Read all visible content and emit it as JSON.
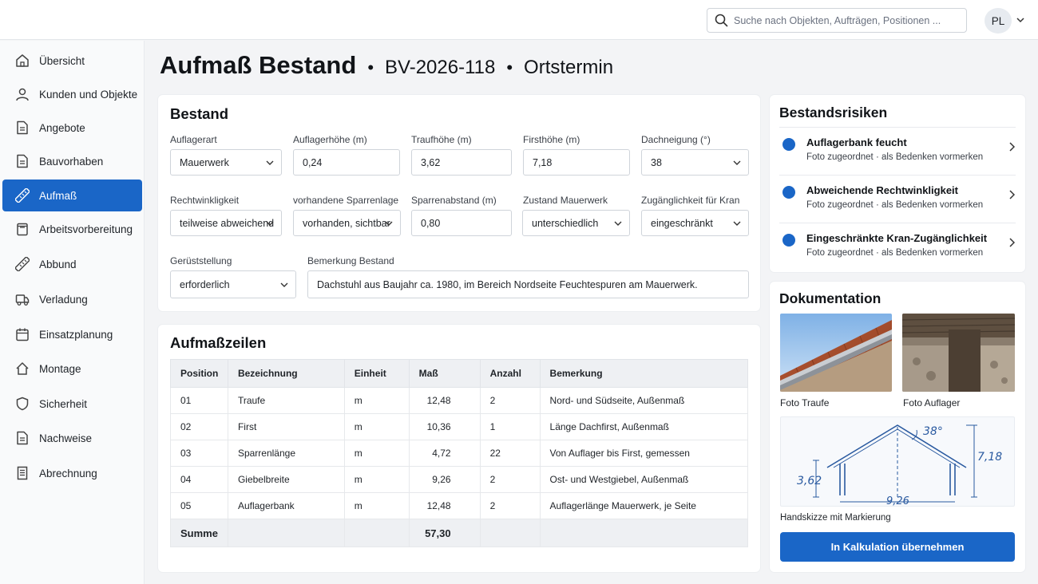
{
  "header": {
    "search_placeholder": "Suche nach Objekten, Aufträgen, Positionen ...",
    "avatar_initials": "PL"
  },
  "sidebar": {
    "items": [
      {
        "label": "Übersicht",
        "icon": "home-icon",
        "active": false
      },
      {
        "label": "Kunden und Objekte",
        "icon": "user-icon",
        "active": false
      },
      {
        "label": "Angebote",
        "icon": "document-icon",
        "active": false
      },
      {
        "label": "Bauvorhaben",
        "icon": "document-icon",
        "active": false
      },
      {
        "label": "Aufmaß",
        "icon": "ruler-icon",
        "active": true
      },
      {
        "label": "Arbeitsvorbereitung",
        "icon": "clipboard-icon",
        "active": false
      },
      {
        "label": "Abbund",
        "icon": "ruler-icon",
        "active": false
      },
      {
        "label": "Verladung",
        "icon": "truck-icon",
        "active": false
      },
      {
        "label": "Einsatzplanung",
        "icon": "calendar-icon",
        "active": false
      },
      {
        "label": "Montage",
        "icon": "house-icon",
        "active": false
      },
      {
        "label": "Sicherheit",
        "icon": "shield-icon",
        "active": false
      },
      {
        "label": "Nachweise",
        "icon": "document-icon",
        "active": false
      },
      {
        "label": "Abrechnung",
        "icon": "receipt-icon",
        "active": false
      }
    ]
  },
  "page": {
    "title": "Aufmaß Bestand",
    "separator": "•",
    "project_id": "BV-2026-118",
    "context": "Ortstermin"
  },
  "bestand": {
    "heading": "Bestand",
    "fields": {
      "auflagerart": {
        "label": "Auflagerart",
        "value": "Mauerwerk"
      },
      "auflagerhoehe": {
        "label": "Auflagerhöhe (m)",
        "value": "0,24"
      },
      "traufhoehe": {
        "label": "Traufhöhe (m)",
        "value": "3,62"
      },
      "firsthoehe": {
        "label": "Firsthöhe (m)",
        "value": "7,18"
      },
      "dachneigung": {
        "label": "Dachneigung (°)",
        "value": "38"
      },
      "rechtwinkligkeit": {
        "label": "Rechtwinkligkeit",
        "value": "teilweise abweichend"
      },
      "sparrenlage": {
        "label": "vorhandene Sparrenlage",
        "value": "vorhanden, sichtbar"
      },
      "sparrenabstand": {
        "label": "Sparrenabstand (m)",
        "value": "0,80"
      },
      "zustand": {
        "label": "Zustand Mauerwerk",
        "value": "unterschiedlich"
      },
      "kran": {
        "label": "Zugänglichkeit für Kran",
        "value": "eingeschränkt"
      },
      "geruest": {
        "label": "Gerüststellung",
        "value": "erforderlich"
      },
      "bemerkung": {
        "label": "Bemerkung Bestand",
        "value": "Dachstuhl aus Baujahr ca. 1980, im Bereich Nordseite Feuchtespuren am Mauerwerk."
      }
    }
  },
  "aufmass": {
    "heading": "Aufmaßzeilen",
    "columns": [
      "Position",
      "Bezeichnung",
      "Einheit",
      "Maß",
      "Anzahl",
      "Bemerkung"
    ],
    "rows": [
      [
        "01",
        "Traufe",
        "m",
        "12,48",
        "2",
        "Nord- und Südseite, Außenmaß"
      ],
      [
        "02",
        "First",
        "m",
        "10,36",
        "1",
        "Länge Dachfirst, Außenmaß"
      ],
      [
        "03",
        "Sparrenlänge",
        "m",
        "4,72",
        "22",
        "Von Auflager bis First, gemessen"
      ],
      [
        "04",
        "Giebelbreite",
        "m",
        "9,26",
        "2",
        "Ost- und Westgiebel, Außenmaß"
      ],
      [
        "05",
        "Auflagerbank",
        "m",
        "12,48",
        "2",
        "Auflagerlänge Mauerwerk, je Seite"
      ]
    ],
    "sum_label": "Summe",
    "sum_value": "57,30"
  },
  "risks": {
    "heading": "Bestandsrisiken",
    "items": [
      {
        "title": "Auflagerbank feucht",
        "meta": "Foto zugeordnet · als Bedenken vormerken"
      },
      {
        "title": "Abweichende Rechtwinkligkeit",
        "meta": "Foto zugeordnet · als Bedenken vormerken"
      },
      {
        "title": "Eingeschränkte Kran-Zugänglichkeit",
        "meta": "Foto zugeordnet · als Bedenken vormerken"
      }
    ]
  },
  "docs": {
    "heading": "Dokumentation",
    "photo1_label": "Foto Traufe",
    "photo2_label": "Foto Auflager",
    "sketch_label": "Handskizze mit Markierung",
    "sketch": {
      "angle": "38°",
      "height_eave": "3,62",
      "height_ridge": "7,18",
      "width": "9,26"
    },
    "button_label": "In Kalkulation übernehmen"
  },
  "colors": {
    "accent": "#1a66c7",
    "sketch_ink": "#2a5aa0"
  }
}
